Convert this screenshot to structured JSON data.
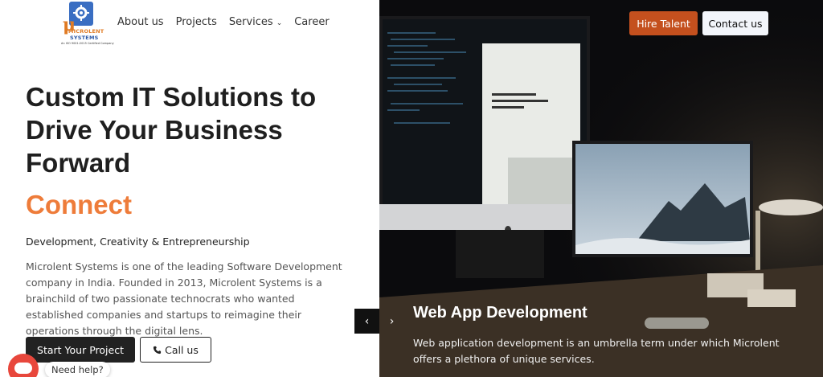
{
  "logo": {
    "name_line1": "MICROLENT",
    "name_line2": "SYSTEMS",
    "tagline": "An ISO 9001:2015 Certified Company"
  },
  "nav": {
    "items": [
      {
        "label": "About us"
      },
      {
        "label": "Projects"
      },
      {
        "label": "Services",
        "has_dropdown": true
      },
      {
        "label": "Career"
      }
    ]
  },
  "header_actions": {
    "hire_label": "Hire Talent",
    "contact_label": "Contact us"
  },
  "hero": {
    "title": "Custom IT Solutions to Drive Your Business Forward",
    "rotating_word": "Connect",
    "subheading": "Development, Creativity & Entrepreneurship",
    "description": "Microlent Systems is one of the leading Software Development company in India. Founded in 2013, Microlent Systems is a brainchild of two passionate technocrats who wanted established companies and startups to reimagine their operations through the digital lens.",
    "primary_button": "Start Your Project",
    "secondary_button": "Call us"
  },
  "slide": {
    "title": "Web App Development",
    "description": "Web application development is an umbrella term under which Microlent offers a plethora of unique services."
  },
  "slider_controls": {
    "prev_icon": "‹",
    "next_icon": "›"
  },
  "chat": {
    "label": "Need help?"
  },
  "colors": {
    "accent_orange": "#ee7c3a",
    "hire_button": "#c4501e",
    "dark_bg": "#0b0b0d"
  }
}
